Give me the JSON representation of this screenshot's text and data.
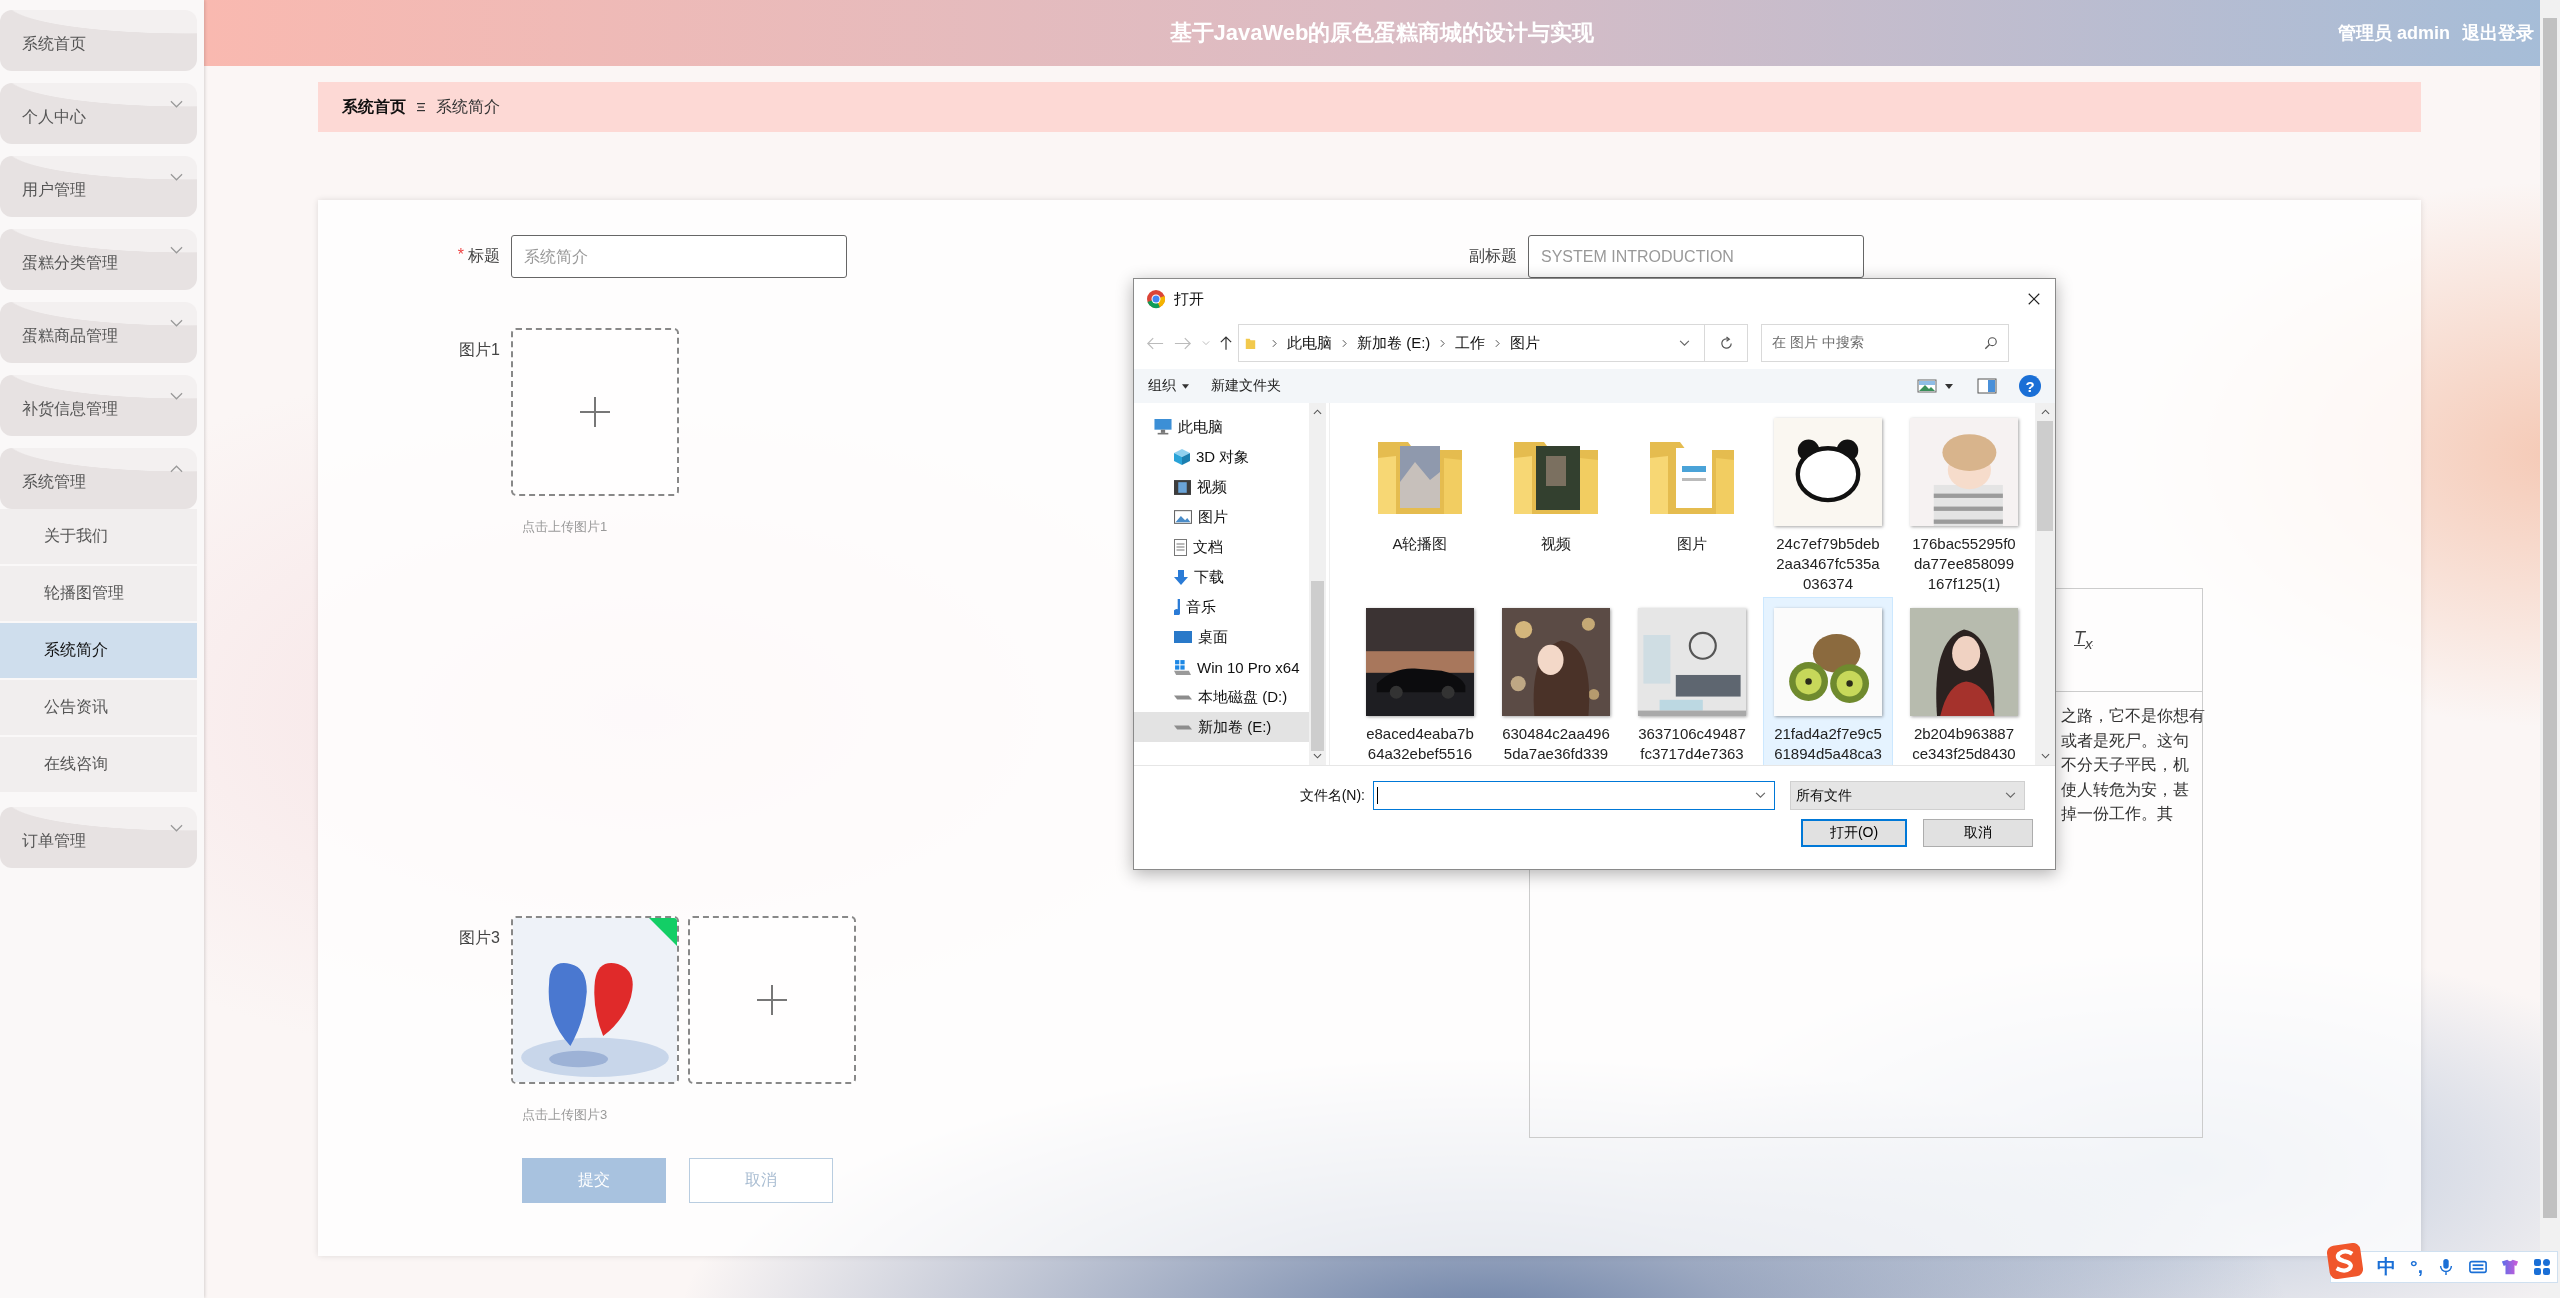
{
  "header": {
    "title": "基于JavaWeb的原色蛋糕商城的设计与实现",
    "user": "管理员 admin",
    "logout": "退出登录"
  },
  "sidebar": {
    "items": [
      {
        "label": "系统首页",
        "kind": "link"
      },
      {
        "label": "个人中心",
        "kind": "menu",
        "expanded": false
      },
      {
        "label": "用户管理",
        "kind": "menu",
        "expanded": false
      },
      {
        "label": "蛋糕分类管理",
        "kind": "menu",
        "expanded": false
      },
      {
        "label": "蛋糕商品管理",
        "kind": "menu",
        "expanded": false
      },
      {
        "label": "补货信息管理",
        "kind": "menu",
        "expanded": false
      },
      {
        "label": "系统管理",
        "kind": "menu",
        "expanded": true,
        "children": [
          {
            "label": "关于我们",
            "selected": false
          },
          {
            "label": "轮播图管理",
            "selected": false
          },
          {
            "label": "系统简介",
            "selected": true
          },
          {
            "label": "公告资讯",
            "selected": false
          },
          {
            "label": "在线咨询",
            "selected": false
          }
        ]
      },
      {
        "label": "订单管理",
        "kind": "menu",
        "expanded": false
      }
    ]
  },
  "breadcrumb": {
    "items": [
      "系统首页",
      "系统简介"
    ]
  },
  "form": {
    "title": {
      "required_mark": "*",
      "label": "标题",
      "placeholder": "系统简介"
    },
    "subtitle": {
      "label": "副标题",
      "placeholder": "SYSTEM INTRODUCTION"
    },
    "image1": {
      "label": "图片1",
      "hint": "点击上传图片1"
    },
    "image3": {
      "label": "图片3",
      "hint": "点击上传图片3",
      "uploaded": true
    },
    "editor": {
      "clear_format": "T$_{x}$",
      "lines": [
        "之路，它不是你想有",
        "或者是死尸。这句",
        "不分天子平民，机",
        "使人转危为安，甚",
        "掉一份工作。其"
      ]
    },
    "submit": "提交",
    "cancel": "取消"
  },
  "dialog": {
    "title": "打开",
    "path": [
      "此电脑",
      "新加卷 (E:)",
      "工作",
      "图片"
    ],
    "search_placeholder": "在 图片 中搜索",
    "organize": "组织",
    "new_folder": "新建文件夹",
    "help": "?",
    "nav": [
      {
        "label": "此电脑",
        "kind": "pc",
        "selected": false
      },
      {
        "label": "3D 对象",
        "kind": "cube",
        "selected": false
      },
      {
        "label": "视频",
        "kind": "video",
        "selected": false
      },
      {
        "label": "图片",
        "kind": "pictures",
        "selected": false
      },
      {
        "label": "文档",
        "kind": "documents",
        "selected": false
      },
      {
        "label": "下载",
        "kind": "download",
        "selected": false
      },
      {
        "label": "音乐",
        "kind": "music",
        "selected": false
      },
      {
        "label": "桌面",
        "kind": "desktop",
        "selected": false
      },
      {
        "label": "Win 10 Pro x64",
        "kind": "windows-drive",
        "selected": false
      },
      {
        "label": "本地磁盘 (D:)",
        "kind": "drive",
        "selected": false
      },
      {
        "label": "新加卷 (E:)",
        "kind": "drive",
        "selected": true
      }
    ],
    "files": [
      {
        "kind": "folder",
        "name_lines": [
          "A轮播图"
        ],
        "selected": false
      },
      {
        "kind": "folder",
        "name_lines": [
          "视频"
        ],
        "selected": false
      },
      {
        "kind": "folder",
        "name_lines": [
          "图片"
        ],
        "selected": false
      },
      {
        "name_lines": [
          "24c7ef79b5deb",
          "2aa3467fc535a",
          "036374"
        ],
        "selected": false
      },
      {
        "name_lines": [
          "176bac55295f0",
          "da77ee858099",
          "167f125(1)"
        ],
        "selected": false
      },
      {
        "name_lines": [
          "e8aced4eaba7b",
          "64a32ebef5516"
        ],
        "selected": false
      },
      {
        "name_lines": [
          "630484c2aa496",
          "5da7ae36fd339"
        ],
        "selected": false
      },
      {
        "name_lines": [
          "3637106c49487",
          "fc3717d4e7363"
        ],
        "selected": false
      },
      {
        "name_lines": [
          "21fad4a2f7e9c5",
          "61894d5a48ca3"
        ],
        "selected": true
      },
      {
        "name_lines": [
          "2b204b963887",
          "ce343f25d8430"
        ],
        "selected": false
      }
    ],
    "filename_label": "文件名(N):",
    "filetype": "所有文件",
    "open": "打开(O)",
    "cancel": "取消"
  },
  "ime": {
    "mode": "中",
    "punct": "°,"
  }
}
